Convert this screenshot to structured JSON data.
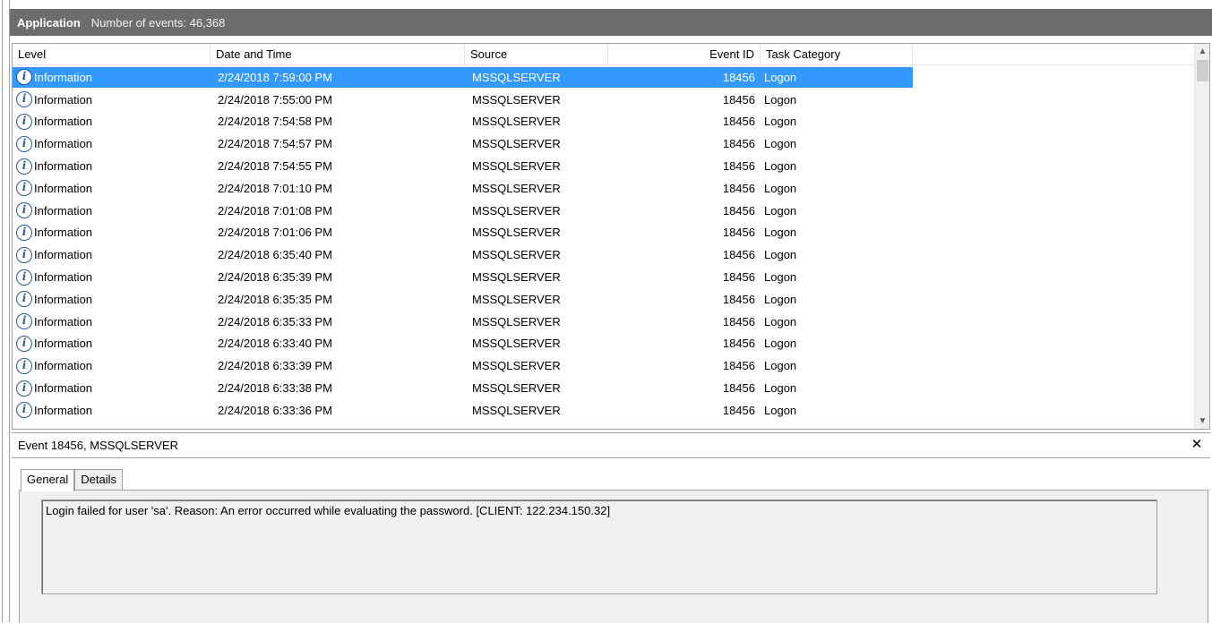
{
  "titlebar": {
    "app_name": "Application",
    "event_count": "Number of events: 46,368"
  },
  "columns": {
    "level": "Level",
    "date": "Date and Time",
    "source": "Source",
    "event_id": "Event ID",
    "task_category": "Task Category"
  },
  "rows": [
    {
      "level": "Information",
      "date": "2/24/2018 7:59:00 PM",
      "source": "MSSQLSERVER",
      "event_id": "18456",
      "task": "Logon"
    },
    {
      "level": "Information",
      "date": "2/24/2018 7:55:00 PM",
      "source": "MSSQLSERVER",
      "event_id": "18456",
      "task": "Logon"
    },
    {
      "level": "Information",
      "date": "2/24/2018 7:54:58 PM",
      "source": "MSSQLSERVER",
      "event_id": "18456",
      "task": "Logon"
    },
    {
      "level": "Information",
      "date": "2/24/2018 7:54:57 PM",
      "source": "MSSQLSERVER",
      "event_id": "18456",
      "task": "Logon"
    },
    {
      "level": "Information",
      "date": "2/24/2018 7:54:55 PM",
      "source": "MSSQLSERVER",
      "event_id": "18456",
      "task": "Logon"
    },
    {
      "level": "Information",
      "date": "2/24/2018 7:01:10 PM",
      "source": "MSSQLSERVER",
      "event_id": "18456",
      "task": "Logon"
    },
    {
      "level": "Information",
      "date": "2/24/2018 7:01:08 PM",
      "source": "MSSQLSERVER",
      "event_id": "18456",
      "task": "Logon"
    },
    {
      "level": "Information",
      "date": "2/24/2018 7:01:06 PM",
      "source": "MSSQLSERVER",
      "event_id": "18456",
      "task": "Logon"
    },
    {
      "level": "Information",
      "date": "2/24/2018 6:35:40 PM",
      "source": "MSSQLSERVER",
      "event_id": "18456",
      "task": "Logon"
    },
    {
      "level": "Information",
      "date": "2/24/2018 6:35:39 PM",
      "source": "MSSQLSERVER",
      "event_id": "18456",
      "task": "Logon"
    },
    {
      "level": "Information",
      "date": "2/24/2018 6:35:35 PM",
      "source": "MSSQLSERVER",
      "event_id": "18456",
      "task": "Logon"
    },
    {
      "level": "Information",
      "date": "2/24/2018 6:35:33 PM",
      "source": "MSSQLSERVER",
      "event_id": "18456",
      "task": "Logon"
    },
    {
      "level": "Information",
      "date": "2/24/2018 6:33:40 PM",
      "source": "MSSQLSERVER",
      "event_id": "18456",
      "task": "Logon"
    },
    {
      "level": "Information",
      "date": "2/24/2018 6:33:39 PM",
      "source": "MSSQLSERVER",
      "event_id": "18456",
      "task": "Logon"
    },
    {
      "level": "Information",
      "date": "2/24/2018 6:33:38 PM",
      "source": "MSSQLSERVER",
      "event_id": "18456",
      "task": "Logon"
    },
    {
      "level": "Information",
      "date": "2/24/2018 6:33:36 PM",
      "source": "MSSQLSERVER",
      "event_id": "18456",
      "task": "Logon"
    }
  ],
  "icons": {
    "info": "i",
    "close": "✕",
    "scroll_up": "▲",
    "scroll_down": "▼"
  },
  "detail": {
    "header": "Event 18456, MSSQLSERVER",
    "tabs": [
      "General",
      "Details"
    ],
    "active_tab": "General",
    "message": "Login failed for user 'sa'. Reason: An error occurred while evaluating the password. [CLIENT: 122.234.150.32]"
  },
  "colors": {
    "selection": "#3399ff",
    "titlebar": "#6d6d6d"
  }
}
